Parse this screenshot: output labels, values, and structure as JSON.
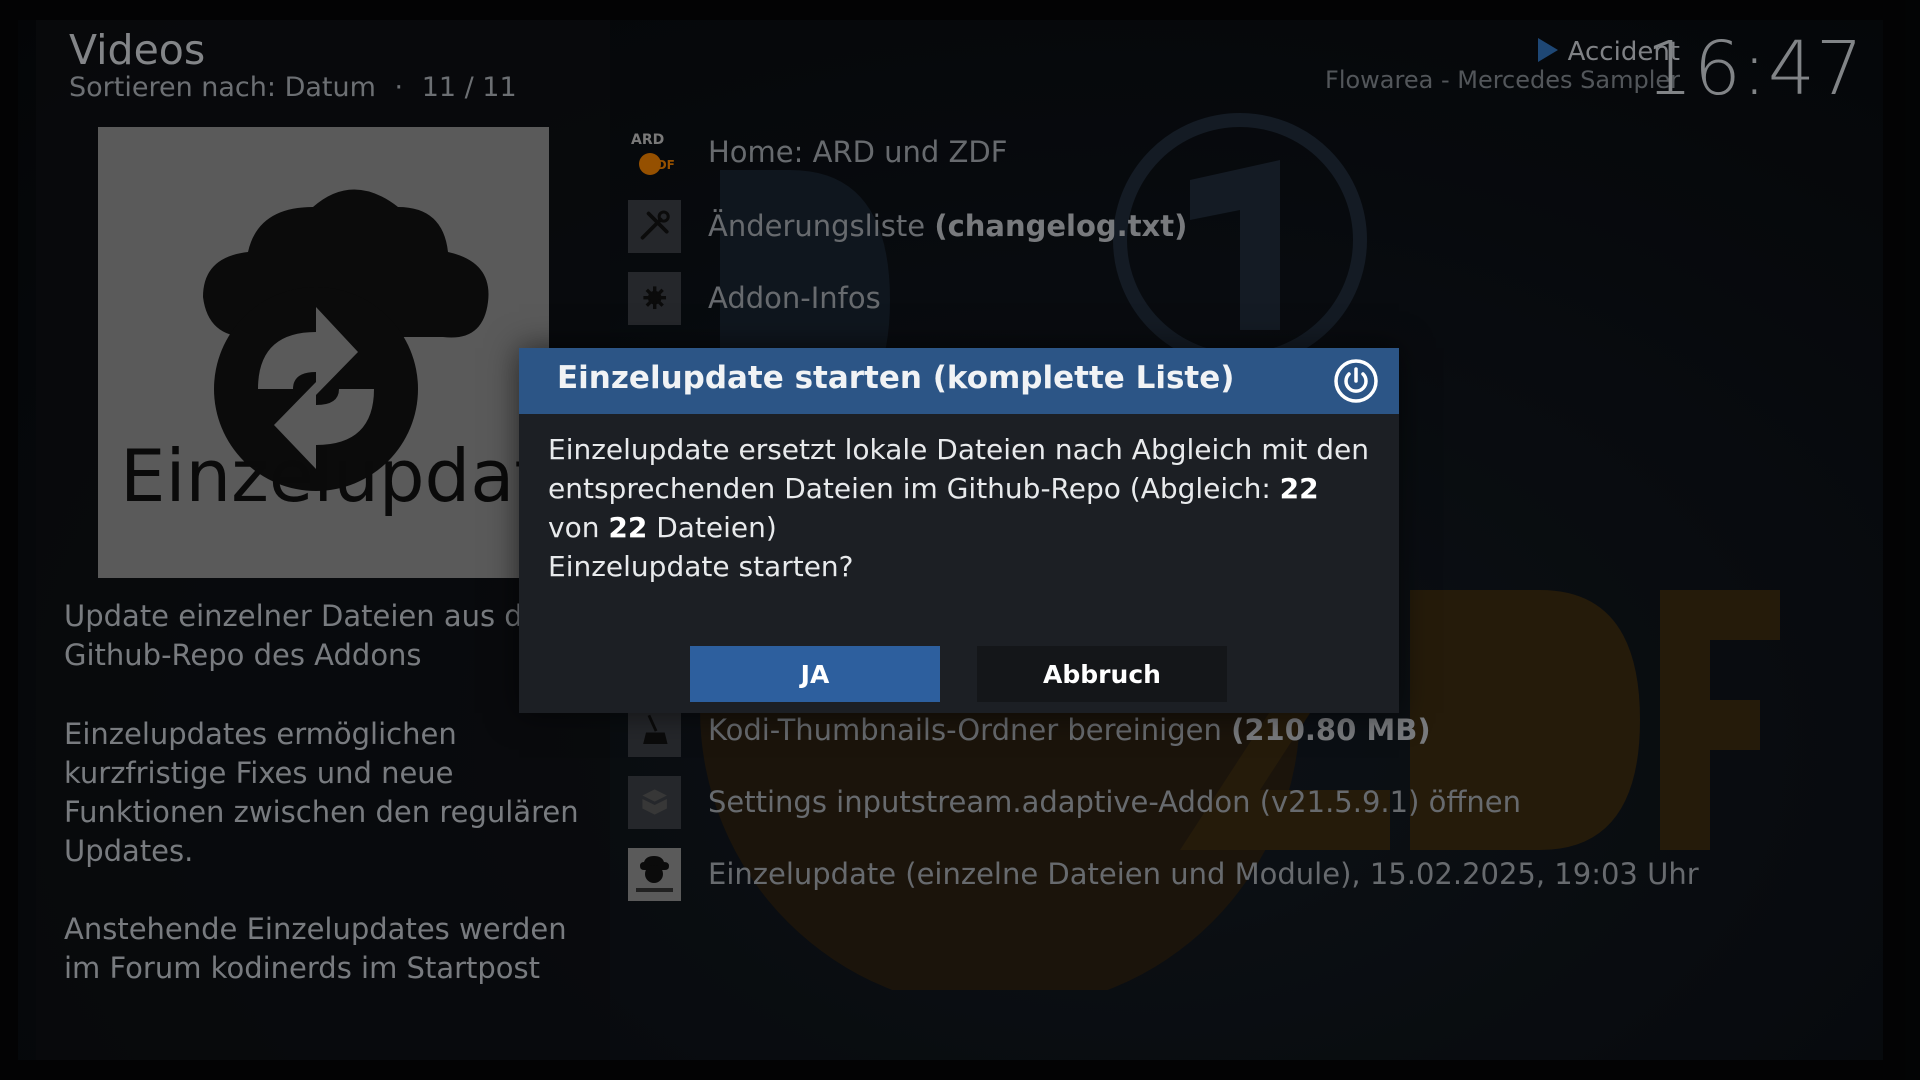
{
  "header": {
    "title": "Videos",
    "sort_label": "Sortieren nach: Datum",
    "separator": "·",
    "count": "11 / 11"
  },
  "now_playing": {
    "title": "Accident",
    "artist_album": "Flowarea - Mercedes Sampler"
  },
  "clock": "16:47",
  "thumbnail": {
    "label": "Einzelupdate",
    "background": "#8a8a8a"
  },
  "plot": {
    "p1": "Update einzelner Dateien aus dem Github-Repo des Addons",
    "p2": "Einzelupdates ermöglichen kurzfristige Fixes und neue Funktionen zwischen den regulären Updates.",
    "p3": "Anstehende Einzelupdates werden im Forum kodinerds im Startpost"
  },
  "list": {
    "items": [
      {
        "label": "Home: ARD und ZDF",
        "icon": "ard-zdf-logo-icon"
      },
      {
        "label": "Änderungsliste",
        "suffix": "(changelog.txt)",
        "icon": "tools-icon"
      },
      {
        "label": "Addon-Infos",
        "icon": "gear-icon"
      },
      {
        "label": "Kodi-Thumbnails-Ordner bereinigen",
        "suffix": "(210.80 MB)",
        "icon": "broom-icon"
      },
      {
        "label": "Settings inputstream.adaptive-Addon (v21.5.9.1) öffnen",
        "icon": "box-icon"
      },
      {
        "label": "Einzelupdate (einzelne Dateien und Module), 15.02.2025, 19:03 Uhr",
        "icon": "einzelupdate-icon"
      }
    ]
  },
  "dialog": {
    "title": "Einzelupdate starten (komplette Liste)",
    "body_line1": "Einzelupdate ersetzt lokale Dateien nach Abgleich mit den entsprechenden Dateien im Github-Repo (Abgleich: ",
    "count_a": "22",
    "between": " von ",
    "count_b": "22",
    "body_line1_end": " Dateien)",
    "question": "Einzelupdate starten?",
    "yes_label": "JA",
    "cancel_label": "Abbruch"
  },
  "colors": {
    "accent": "#2d5f9e",
    "dialog_header": "#2c5586",
    "dialog_bg": "#1c1f24",
    "zdf_orange": "#e57b00"
  }
}
